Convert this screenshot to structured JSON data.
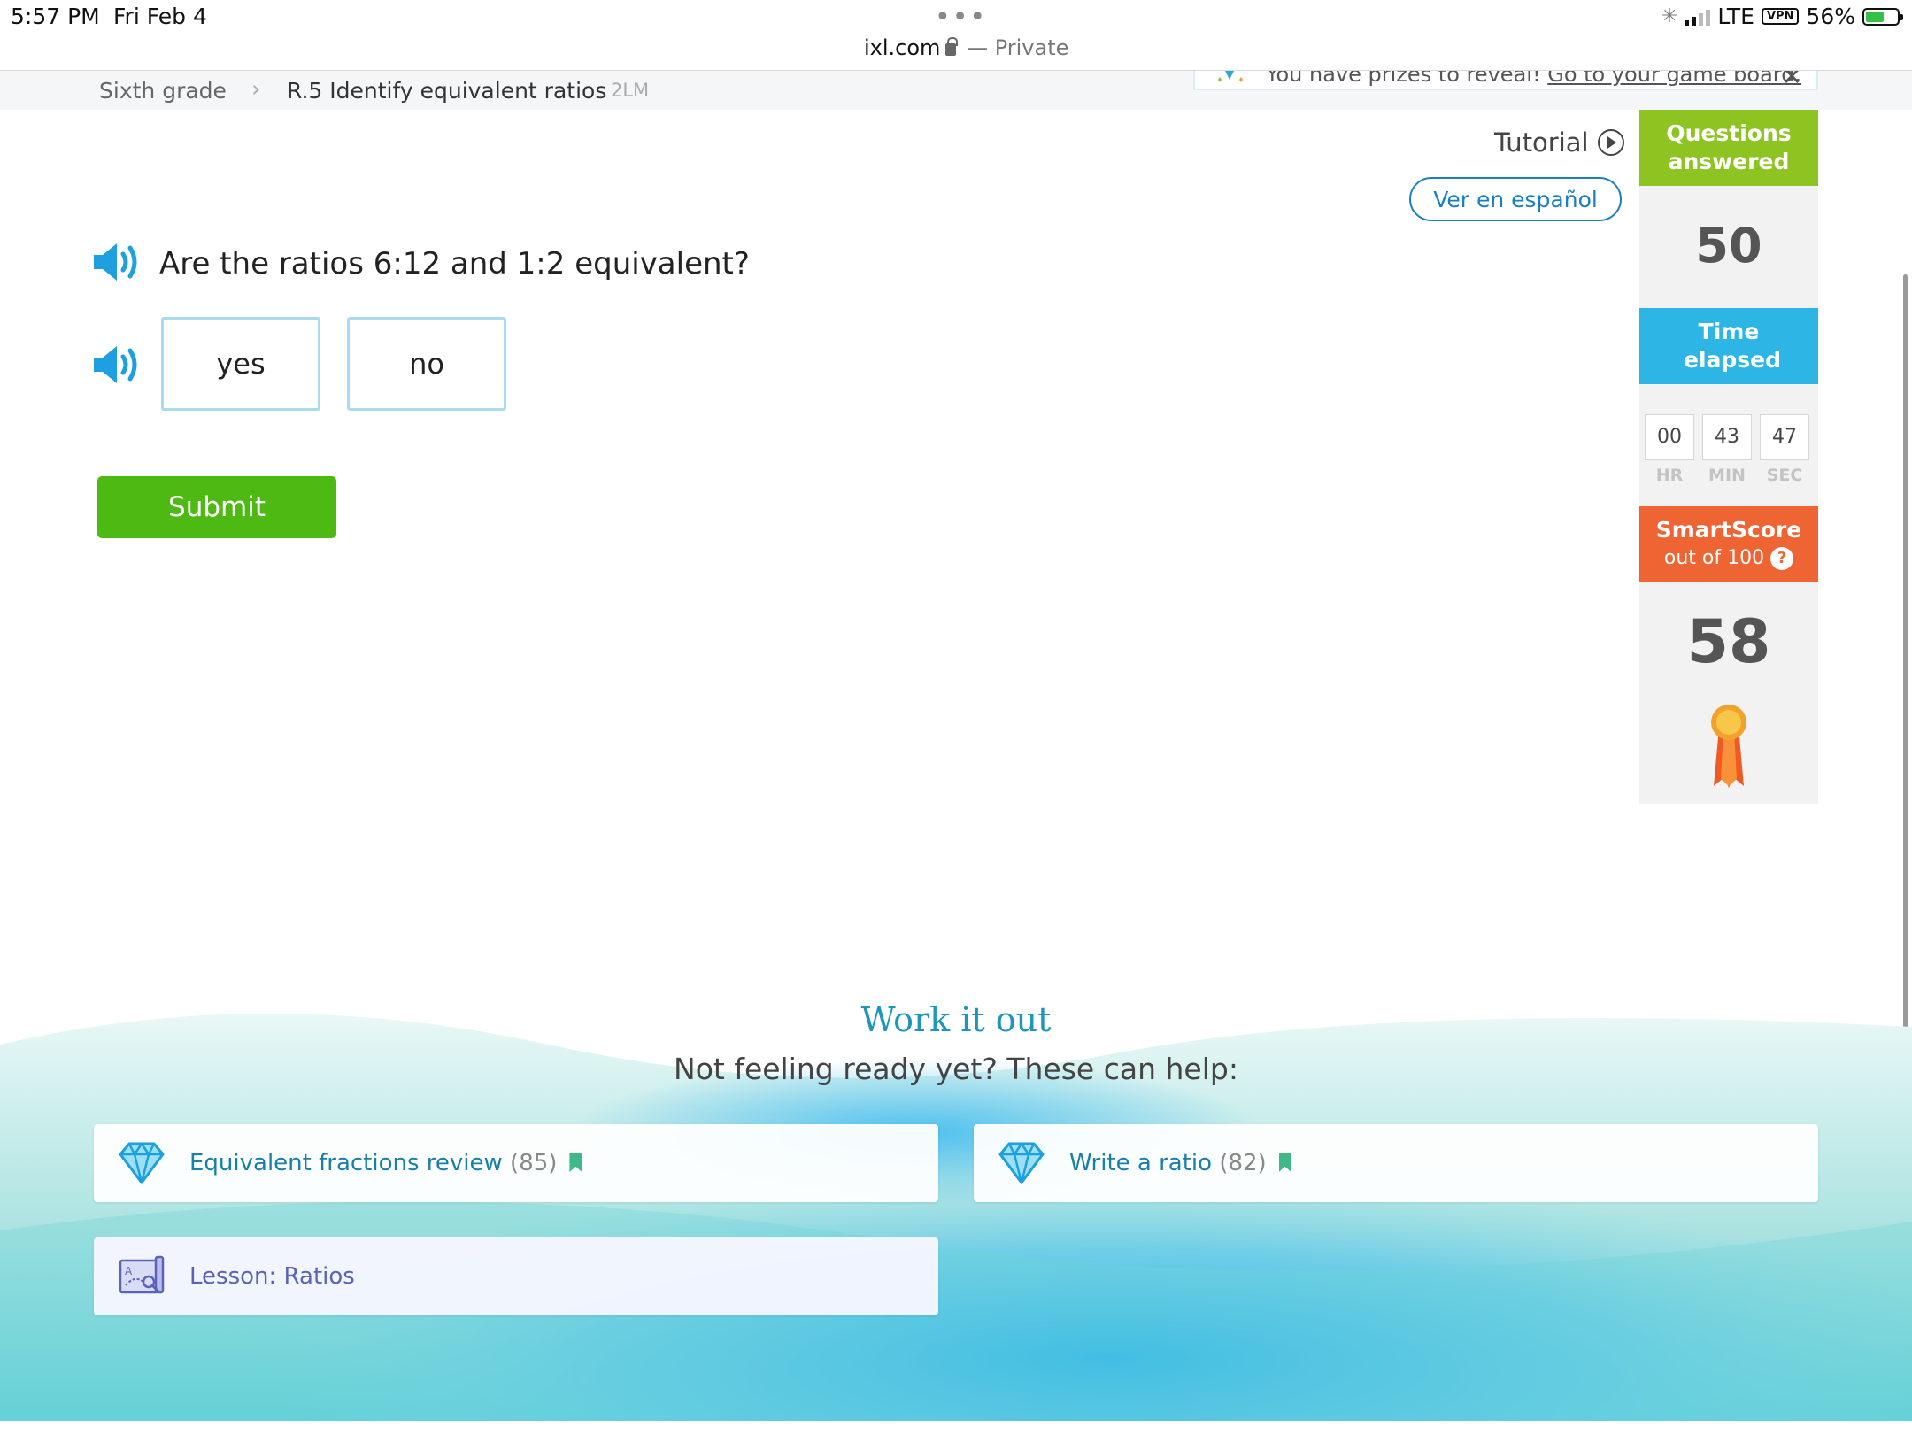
{
  "status": {
    "time": "5:57 PM",
    "date": "Fri Feb 4",
    "url": "ixl.com",
    "private": "— Private",
    "network": "LTE",
    "vpn": "VPN",
    "battery": "56%"
  },
  "breadcrumb": {
    "grade": "Sixth grade",
    "skill": "R.5 Identify equivalent ratios",
    "code": "2LM"
  },
  "prize_banner": {
    "text": "You have prizes to reveal!",
    "link": "Go to your game board."
  },
  "toolbar": {
    "tutorial_label": "Tutorial",
    "spanish_label": "Ver en español"
  },
  "question": {
    "text": "Are the ratios 6:12 and 1:2 equivalent?",
    "choices": [
      "yes",
      "no"
    ],
    "submit_label": "Submit"
  },
  "stats": {
    "questions_title": "Questions answered",
    "questions_value": "50",
    "time_title": "Time elapsed",
    "time": {
      "hr": "00",
      "min": "43",
      "sec": "47",
      "hr_label": "HR",
      "min_label": "MIN",
      "sec_label": "SEC"
    },
    "smartscore_title": "SmartScore",
    "smartscore_sub": "out of 100",
    "smartscore_help": "?",
    "smartscore_value": "58"
  },
  "help": {
    "title": "Work it out",
    "subtitle": "Not feeling ready yet? These can help:",
    "items": [
      {
        "label": "Equivalent fractions review",
        "count": "(85)"
      },
      {
        "label": "Write a ratio",
        "count": "(82)"
      },
      {
        "label": "Lesson: Ratios"
      }
    ]
  },
  "colors": {
    "questions_green": "#8ec422",
    "time_blue": "#2cb5e5",
    "smartscore_orange": "#ee6432",
    "submit_green": "#4db913",
    "link_blue": "#1a7fc1",
    "speaker_blue": "#1d9fe0"
  },
  "icons": {
    "speaker": "speaker-icon",
    "tutorial": "play-circle-icon",
    "diamond": "diamond-icon",
    "lesson": "lesson-icon",
    "ribbon": "award-ribbon-icon",
    "bookmark": "bookmark-icon"
  }
}
